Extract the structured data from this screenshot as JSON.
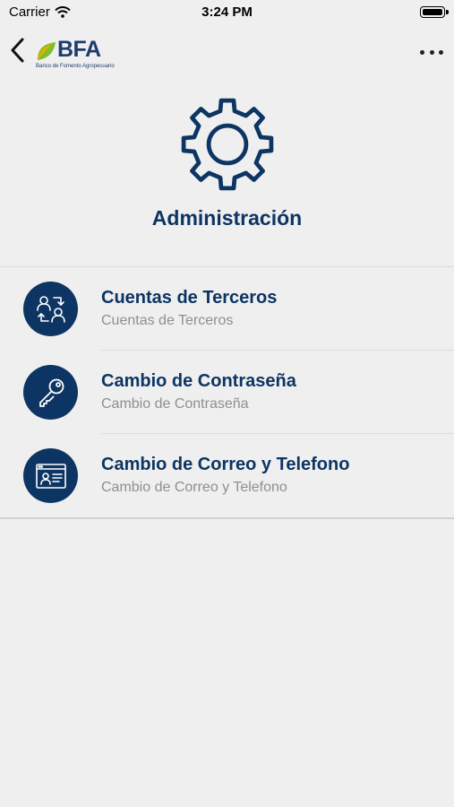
{
  "status_bar": {
    "carrier": "Carrier",
    "time": "3:24 PM"
  },
  "nav": {
    "logo_text": "BFA",
    "logo_subtitle": "Banco de Fomento Agropecuario",
    "logo_colors": [
      "#f2a900",
      "#7bbf2a"
    ]
  },
  "page": {
    "title": "Administración",
    "icon": "gear-icon"
  },
  "menu": {
    "items": [
      {
        "title": "Cuentas de Terceros",
        "subtitle": "Cuentas de Terceros",
        "icon": "transfer-users-icon"
      },
      {
        "title": "Cambio de Contraseña",
        "subtitle": "Cambio de Contraseña",
        "icon": "key-icon"
      },
      {
        "title": "Cambio de Correo y Telefono",
        "subtitle": "Cambio de Correo y Telefono",
        "icon": "profile-card-icon"
      }
    ]
  },
  "colors": {
    "primary": "#0d3563",
    "background": "#efefef",
    "subtitle": "#8f8f8f"
  }
}
